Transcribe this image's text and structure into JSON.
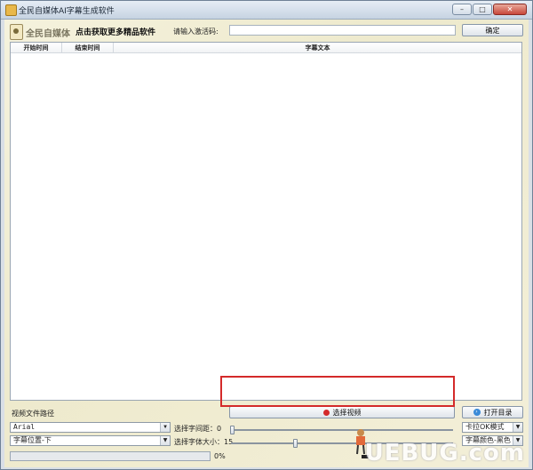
{
  "window": {
    "title": "全民自媒体AI字幕生成软件"
  },
  "header": {
    "logo_text": "全民自媒体",
    "promo_link": "点击获取更多精品软件",
    "code_label": "请输入激活码:",
    "code_value": "",
    "confirm_label": "确定"
  },
  "table": {
    "columns": [
      "开始时间",
      "结束时间",
      "字幕文本"
    ],
    "rows": []
  },
  "bottom": {
    "video_path_label": "视频文件路径",
    "select_video_label": "选择视频",
    "open_dir_label": "打开目录",
    "font_value": "Arial",
    "position_value": "字幕位置-下",
    "char_spacing_label": "选择字间距：0",
    "char_spacing_value": 0,
    "font_size_label": "选择字体大小：15",
    "font_size_value": 15,
    "mode_value": "卡拉OK模式",
    "color_value": "字幕颜色-黑色",
    "progress_text": "0%",
    "progress_value": 0
  },
  "watermark": "UEBUG.com",
  "colors": {
    "highlight": "#d42a2a",
    "select_icon": "#d42a2a",
    "open_icon": "#3a8ad8"
  }
}
